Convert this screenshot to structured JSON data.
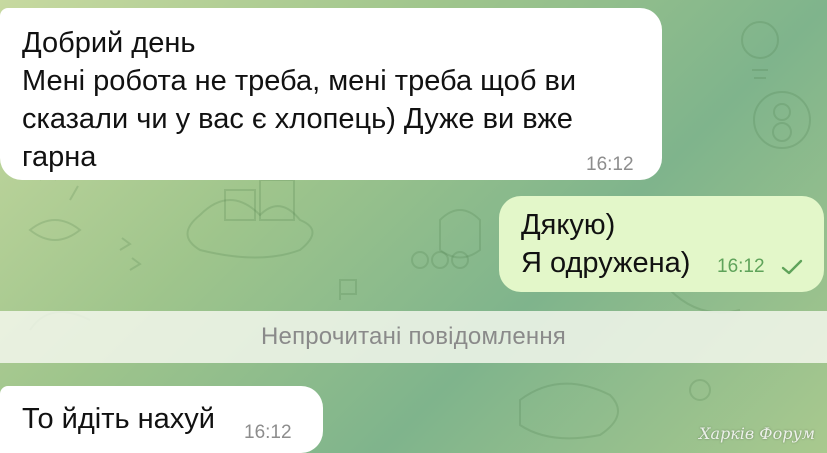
{
  "chat": {
    "messages": [
      {
        "direction": "incoming",
        "text": "Добрий день\nМені робота не треба, мені треба щоб ви\nсказали чи у вас є хлопець) Дуже ви вже\nгарна",
        "time": "16:12"
      },
      {
        "direction": "outgoing",
        "text": "Дякую)\nЯ одружена)",
        "time": "16:12",
        "status_icon": "single-check-icon"
      },
      {
        "direction": "incoming",
        "text": "То йдіть нахуй",
        "time": "16:12"
      }
    ],
    "unread_divider": "Непрочитані повідомлення"
  },
  "watermark": "Харків Форум",
  "colors": {
    "incoming_bubble": "#ffffff",
    "outgoing_bubble": "#e3f7c9",
    "outgoing_time": "#5fa35a",
    "wallpaper": "#9fc58c"
  }
}
